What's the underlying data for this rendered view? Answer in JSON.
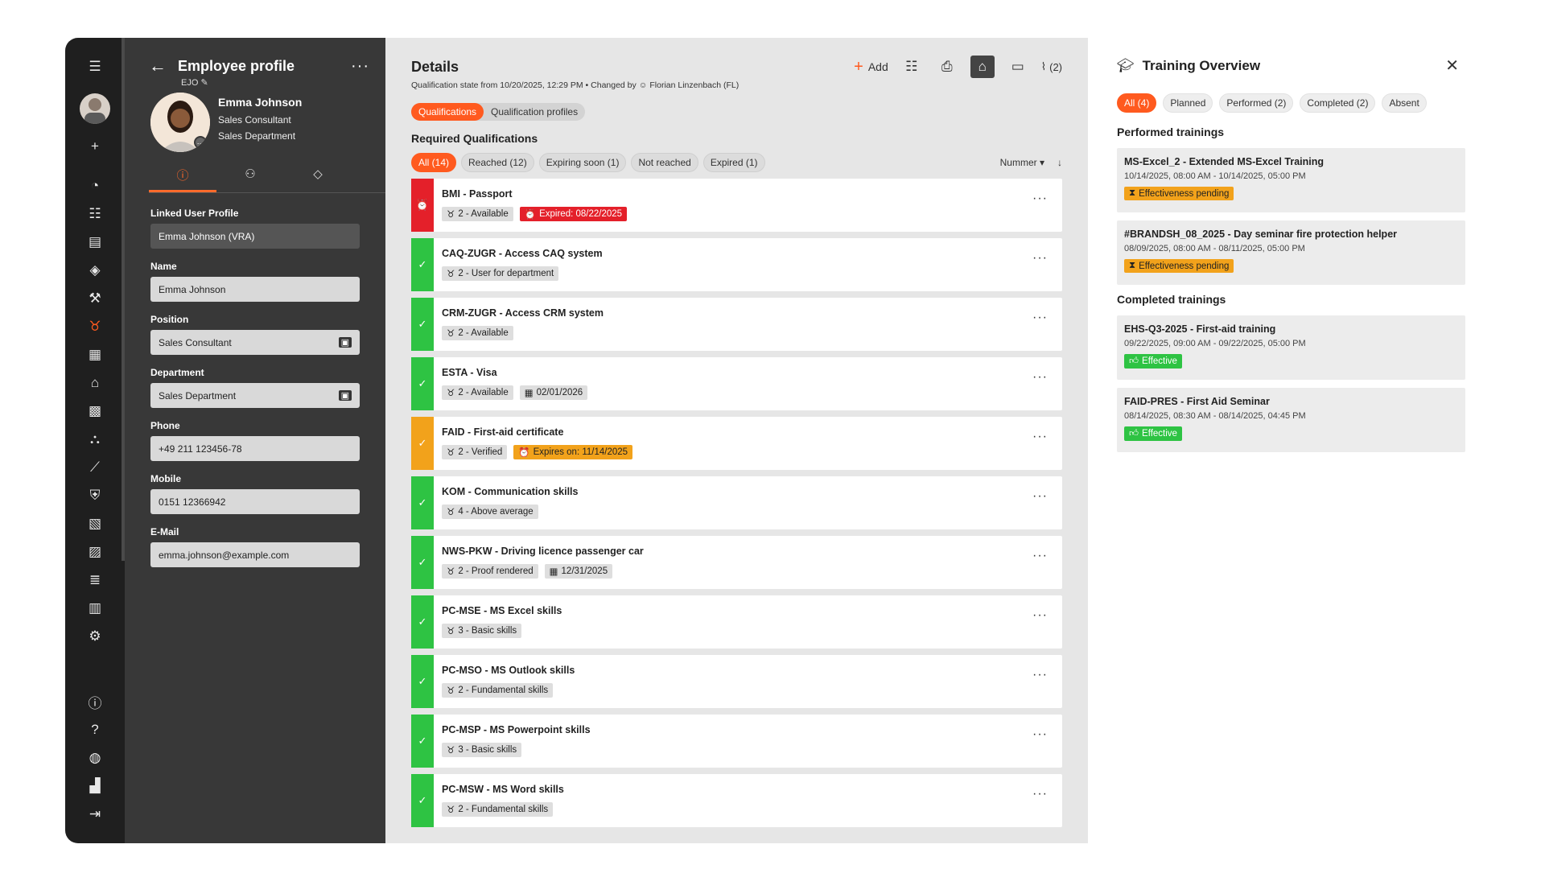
{
  "colors": {
    "accent": "#ff5a1f",
    "reached": "#2ec343",
    "expired": "#e4202a",
    "expiring": "#f2a21b"
  },
  "profile": {
    "title": "Employee profile",
    "code": "EJO",
    "name": "Emma Johnson",
    "role": "Sales Consultant",
    "department": "Sales Department",
    "fields": {
      "linked_label": "Linked User Profile",
      "linked_value": "Emma Johnson (VRA)",
      "name_label": "Name",
      "name_value": "Emma Johnson",
      "position_label": "Position",
      "position_value": "Sales Consultant",
      "department_label": "Department",
      "department_value": "Sales Department",
      "phone_label": "Phone",
      "phone_value": "+49 211 123456-78",
      "mobile_label": "Mobile",
      "mobile_value": "0151 12366942",
      "email_label": "E-Mail",
      "email_value": "emma.johnson@example.com"
    }
  },
  "details": {
    "title": "Details",
    "add_label": "Add",
    "attachments_label": "(2)",
    "qualification_state": "Qualification state from 10/20/2025, 12:29 PM",
    "changed_by_label": "Changed by",
    "changed_by": "Florian Linzenbach (FL)",
    "seg_qualifications": "Qualifications",
    "seg_profiles": "Qualification profiles",
    "required_title": "Required Qualifications",
    "filters": {
      "all": "All (14)",
      "reached": "Reached (12)",
      "expiring": "Expiring soon (1)",
      "not_reached": "Not reached",
      "expired": "Expired (1)"
    },
    "sort_label": "Nummer",
    "items": [
      {
        "name": "BMI - Passport",
        "level": "2 - Available",
        "extra": "Expired: 08/22/2025",
        "status": "expired"
      },
      {
        "name": "CAQ-ZUGR - Access CAQ system",
        "level": "2 - User for department",
        "extra": "",
        "status": "reached"
      },
      {
        "name": "CRM-ZUGR - Access CRM system",
        "level": "2 - Available",
        "extra": "",
        "status": "reached"
      },
      {
        "name": "ESTA - Visa",
        "level": "2 - Available",
        "extra": "02/01/2026",
        "status": "reached"
      },
      {
        "name": "FAID - First-aid certificate",
        "level": "2 - Verified",
        "extra": "Expires on: 11/14/2025",
        "status": "expiring"
      },
      {
        "name": "KOM - Communication skills",
        "level": "4 - Above average",
        "extra": "",
        "status": "reached"
      },
      {
        "name": "NWS-PKW - Driving licence passenger car",
        "level": "2 - Proof rendered",
        "extra": "12/31/2025",
        "status": "reached"
      },
      {
        "name": "PC-MSE - MS Excel skills",
        "level": "3 - Basic skills",
        "extra": "",
        "status": "reached"
      },
      {
        "name": "PC-MSO - MS Outlook skills",
        "level": "2 - Fundamental skills",
        "extra": "",
        "status": "reached"
      },
      {
        "name": "PC-MSP - MS Powerpoint skills",
        "level": "3 - Basic skills",
        "extra": "",
        "status": "reached"
      },
      {
        "name": "PC-MSW - MS Word skills",
        "level": "2 - Fundamental skills",
        "extra": "",
        "status": "reached"
      }
    ]
  },
  "training": {
    "title": "Training Overview",
    "chips": {
      "all": "All (4)",
      "planned": "Planned",
      "performed": "Performed (2)",
      "completed": "Completed (2)",
      "absent": "Absent"
    },
    "performed_title": "Performed trainings",
    "completed_title": "Completed trainings",
    "performed": [
      {
        "name": "MS-Excel_2 - Extended MS-Excel Training",
        "dates": "10/14/2025, 08:00 AM - 10/14/2025, 05:00 PM",
        "status": "Effectiveness pending"
      },
      {
        "name": "#BRANDSH_08_2025 - Day seminar fire protection helper",
        "dates": "08/09/2025, 08:00 AM - 08/11/2025, 05:00 PM",
        "status": "Effectiveness pending"
      }
    ],
    "completed": [
      {
        "name": "EHS-Q3-2025 - First-aid training",
        "dates": "09/22/2025, 09:00 AM - 09/22/2025, 05:00 PM",
        "status": "Effective"
      },
      {
        "name": "FAID-PRES - First Aid Seminar",
        "dates": "08/14/2025, 08:30 AM - 08/14/2025, 04:45 PM",
        "status": "Effective"
      }
    ]
  }
}
